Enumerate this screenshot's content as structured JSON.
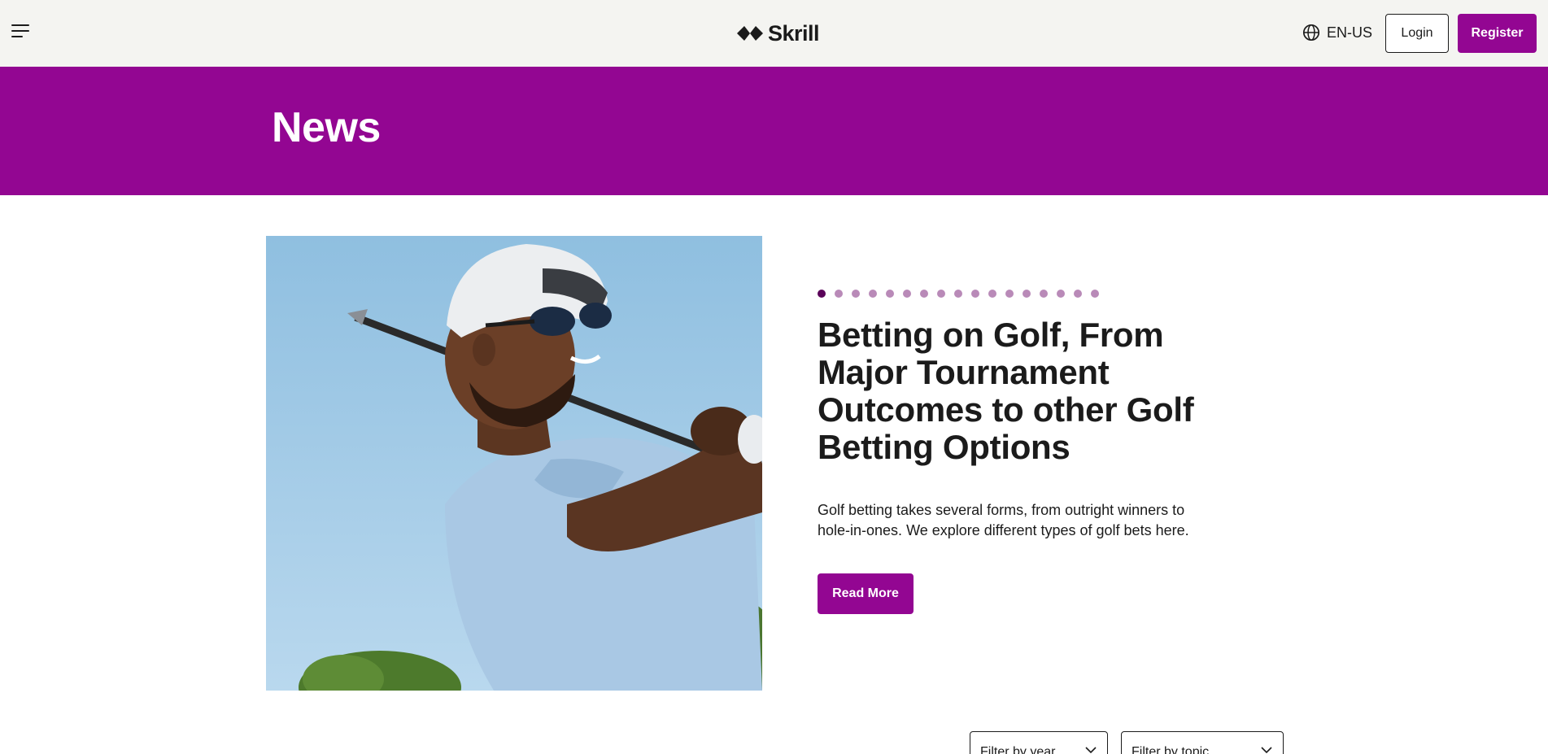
{
  "header": {
    "menu_icon": "hamburger-menu-icon",
    "logo_text": "Skrill",
    "language": {
      "icon": "globe-icon",
      "label": "EN-US"
    },
    "login_label": "Login",
    "register_label": "Register"
  },
  "banner": {
    "title": "News"
  },
  "featured": {
    "image_alt": "golfer-swinging-photo",
    "carousel": {
      "count": 17,
      "active_index": 0
    },
    "title": "Betting on Golf, From Major Tournament Outcomes to other Golf Betting Options",
    "description": "Golf betting takes several forms, from outright winners to hole-in-ones. We explore different types of golf bets here.",
    "read_more_label": "Read More"
  },
  "filters": {
    "year": {
      "placeholder": "Filter by year",
      "icon": "chevron-down-icon"
    },
    "topic": {
      "placeholder": "Filter by topic",
      "icon": "chevron-down-icon"
    }
  },
  "colors": {
    "brand_purple": "#930692",
    "header_bg": "#f4f4f1",
    "dot_active": "#5a0359",
    "dot_inactive": "#b98ab8"
  }
}
